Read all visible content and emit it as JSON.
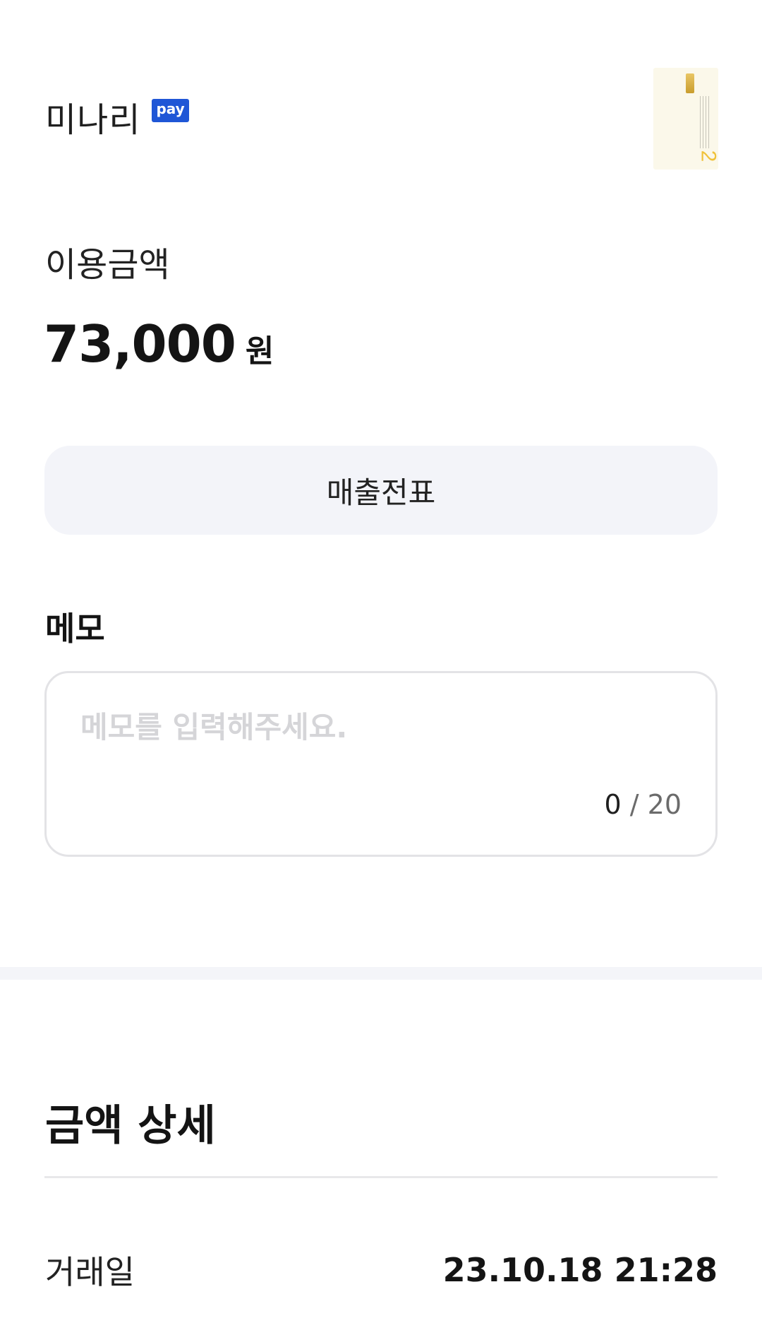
{
  "merchant": {
    "name": "미나리",
    "badge": "pay",
    "card_icon": "card-thumbnail",
    "card_number_mark": "2"
  },
  "amount": {
    "label": "이용금액",
    "value": "73,000",
    "unit": "원"
  },
  "receipt_button": {
    "label": "매출전표"
  },
  "memo": {
    "title": "메모",
    "placeholder": "메모를 입력해주세요.",
    "count": "0",
    "separator": "/",
    "max": "20"
  },
  "details": {
    "title": "금액 상세",
    "rows": [
      {
        "label": "거래일",
        "value": "23.10.18 21:28"
      }
    ]
  },
  "colors": {
    "badge_bg": "#1f56d6",
    "button_bg": "#f3f4f9",
    "divider": "#f4f5f9",
    "card_accent": "#f0c23a"
  }
}
